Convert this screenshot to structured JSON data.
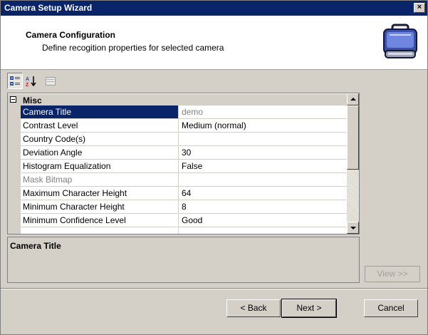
{
  "window": {
    "title": "Camera Setup Wizard",
    "close_glyph": "×"
  },
  "header": {
    "title": "Camera Configuration",
    "subtitle": "Define recogition properties for selected camera",
    "icon": "camera-case-icon"
  },
  "toolbar": {
    "buttons": [
      {
        "icon": "categorized-icon",
        "active": true
      },
      {
        "icon": "sort-alphabetical-icon",
        "active": false
      },
      {
        "icon": "property-pages-icon",
        "active": false,
        "disabled": true
      }
    ]
  },
  "property_grid": {
    "category": "Misc",
    "rows": [
      {
        "name": "Camera Title",
        "value": "demo",
        "selected": true
      },
      {
        "name": "Contrast Level",
        "value": "Medium (normal)"
      },
      {
        "name": "Country Code(s)",
        "value": ""
      },
      {
        "name": "Deviation Angle",
        "value": "30"
      },
      {
        "name": "Histogram Equalization",
        "value": "False"
      },
      {
        "name": "Mask Bitmap",
        "value": "",
        "disabled": true
      },
      {
        "name": "Maximum Character Height",
        "value": "64"
      },
      {
        "name": "Minimum Character Height",
        "value": "8"
      },
      {
        "name": "Minimum Confidence Level",
        "value": "Good"
      }
    ]
  },
  "description": {
    "title": "Camera Title"
  },
  "view_button": "View >>",
  "buttons": {
    "back": "< Back",
    "next": "Next >",
    "cancel": "Cancel"
  },
  "colors": {
    "titlebar": "#0a246a",
    "selection": "#0a246a",
    "face": "#d4d0c8"
  }
}
